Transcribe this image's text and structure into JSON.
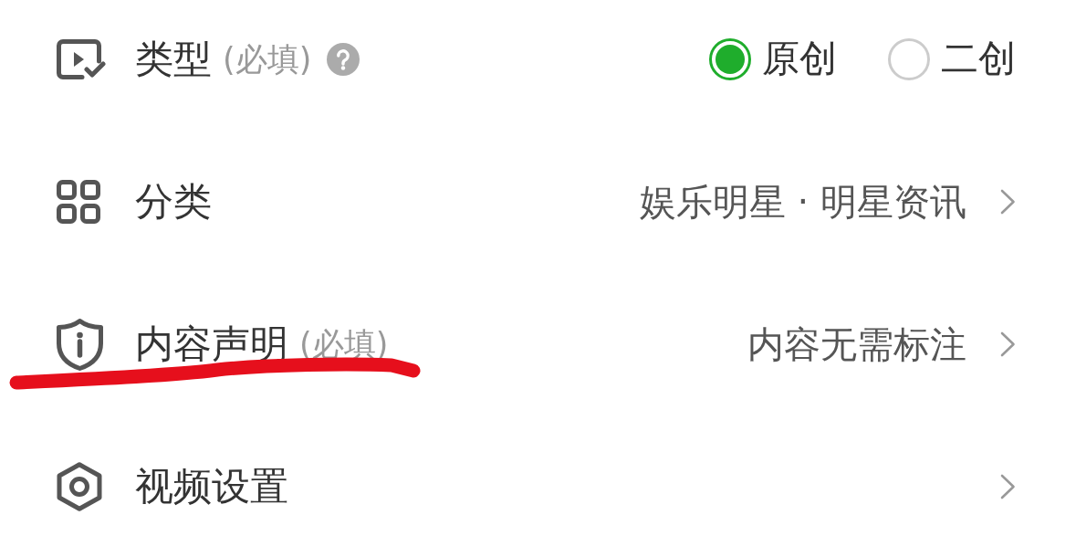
{
  "rows": [
    {
      "kind": "radio",
      "title": "类型",
      "hint": "(必填)",
      "help": true,
      "underlined": false,
      "options": [
        {
          "label": "原创",
          "selected": true
        },
        {
          "label": "二创",
          "selected": false
        }
      ]
    },
    {
      "kind": "link",
      "title": "分类",
      "help": false,
      "underlined": false,
      "value": "娱乐明星 · 明星资讯"
    },
    {
      "kind": "link",
      "title": "内容声明",
      "hint": "(必填)",
      "help": false,
      "underlined": true,
      "value": "内容无需标注"
    },
    {
      "kind": "link",
      "title": "视频设置",
      "help": false,
      "underlined": false
    }
  ]
}
